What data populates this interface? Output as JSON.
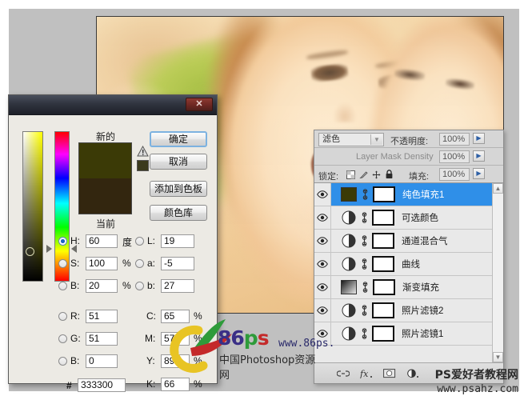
{
  "photo": {
    "alt_description": "warm-toned photo of two young women, close-up faces"
  },
  "color_picker": {
    "close_label": "✕",
    "swatch": {
      "new_label": "新的",
      "current_label": "当前",
      "new_color": "#3b3a06",
      "current_color": "#33260f"
    },
    "buttons": {
      "ok": "确定",
      "cancel": "取消",
      "add_to_swatches": "添加到色板",
      "color_libraries": "颜色库"
    },
    "fields": {
      "h_label": "H:",
      "h_value": "60",
      "h_unit": "度",
      "s_label": "S:",
      "s_value": "100",
      "s_unit": "%",
      "b_label": "B:",
      "b_value": "20",
      "b_unit": "%",
      "r_label": "R:",
      "r_value": "51",
      "g_label": "G:",
      "g_value": "51",
      "b2_label": "B:",
      "b2_value": "0",
      "l_label": "L:",
      "l_value": "19",
      "a_label": "a:",
      "a_value": "-5",
      "bb_label": "b:",
      "bb_value": "27",
      "c_label": "C:",
      "c_value": "65",
      "c_unit": "%",
      "m_label": "M:",
      "m_value": "57",
      "m_unit": "%",
      "y_label": "Y:",
      "y_value": "89",
      "y_unit": "%",
      "k_label": "K:",
      "k_value": "66",
      "k_unit": "%",
      "hex_label": "#",
      "hex_value": "333300"
    }
  },
  "layers_panel": {
    "blend_mode": "滤色",
    "opacity_label": "不透明度:",
    "opacity_value": "100%",
    "mask_density_label": "Layer Mask Density",
    "mask_density_value": "100%",
    "lock_label": "锁定:",
    "fill_label": "填充:",
    "fill_value": "100%",
    "items": [
      {
        "name": "纯色填充1",
        "type": "fill",
        "selected": true,
        "thumb_color": "#3b3a06",
        "visible": true
      },
      {
        "name": "可选颜色",
        "type": "adjustment",
        "selected": false,
        "visible": true
      },
      {
        "name": "通道混合气",
        "type": "adjustment",
        "selected": false,
        "visible": true
      },
      {
        "name": "曲线",
        "type": "adjustment",
        "selected": false,
        "visible": true
      },
      {
        "name": "渐变填充",
        "type": "gradient",
        "selected": false,
        "visible": true
      },
      {
        "name": "照片滤镜2",
        "type": "adjustment",
        "selected": false,
        "visible": true
      },
      {
        "name": "照片滤镜1",
        "type": "adjustment",
        "selected": false,
        "visible": true
      }
    ],
    "scroll_up": "▲",
    "scroll_down": "▼"
  },
  "watermarks": {
    "logo_86": "86",
    "logo_p": "p",
    "logo_s": "s",
    "url_86": "www.86ps.",
    "cn_86": "中国Photoshop资源网",
    "psahz_line1": "PS爱好者教程网",
    "psahz_line2": "www.psahz.com"
  }
}
